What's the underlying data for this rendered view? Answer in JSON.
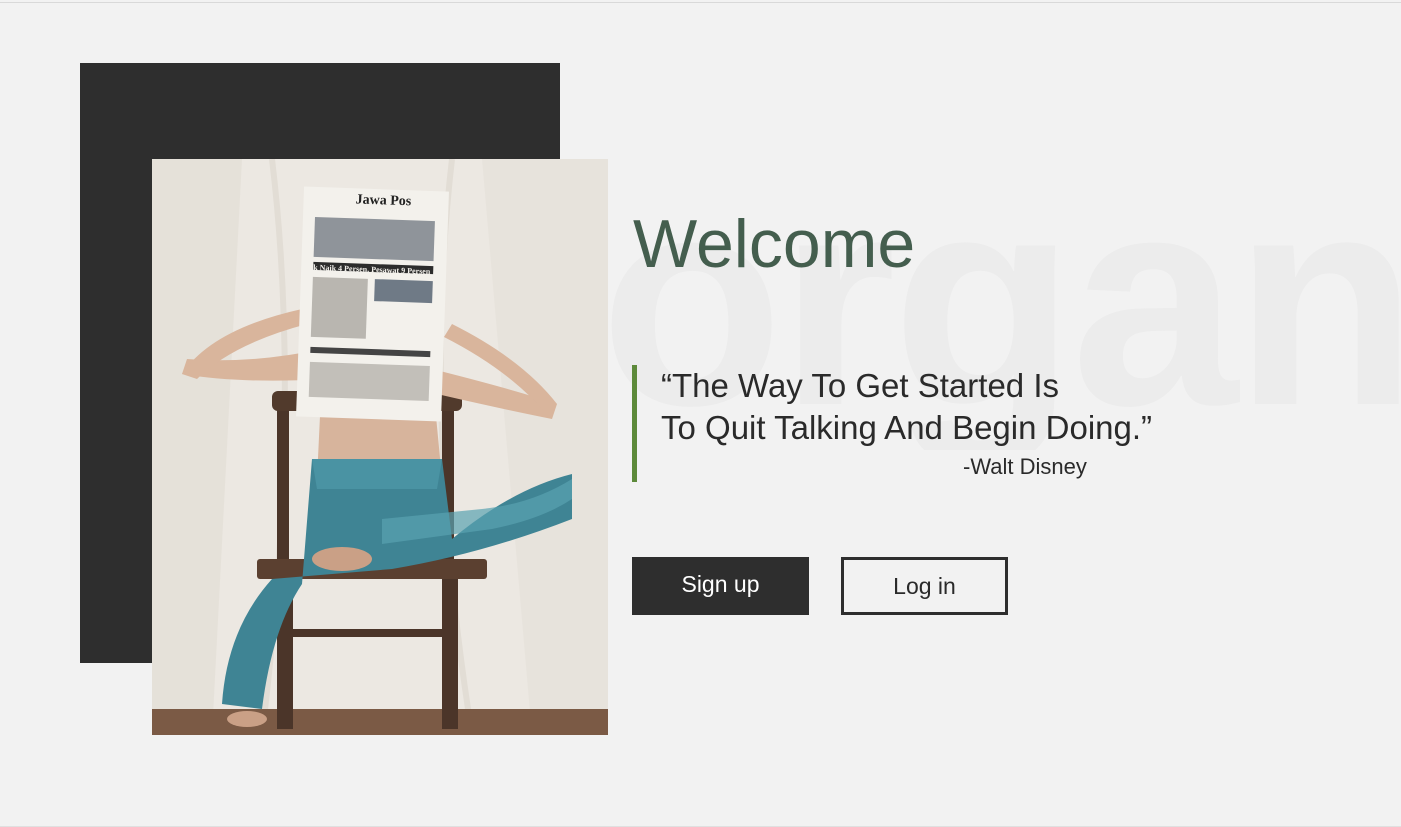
{
  "hero": {
    "background_word": "organ",
    "title": "Welcome",
    "quote": {
      "line1": "“The Way To Get Started Is",
      "line2": "To Quit Talking And Begin Doing.”",
      "author": "-Walt Disney"
    }
  },
  "photo": {
    "newspaper_masthead": "Jawa Pos",
    "newspaper_headline": "k Naik 4 Persen, Pesawat 9 Persen"
  },
  "actions": {
    "signup_label": "Sign up",
    "login_label": "Log in"
  },
  "colors": {
    "background": "#f2f2f2",
    "dark_block": "#2e2e2e",
    "title_green": "#445e4e",
    "quote_border_green": "#5d8a3a"
  }
}
